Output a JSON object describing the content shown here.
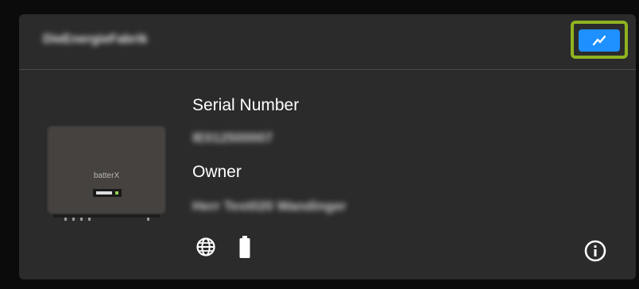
{
  "card": {
    "station_name": "DieEnergieFabrik",
    "chart_button_icon": "chart-icon"
  },
  "device": {
    "image_icon": "inverter-image",
    "brand_text": "batterX",
    "serial_label": "Serial Number",
    "serial_value": "IE012500007",
    "owner_label": "Owner",
    "owner_value": "Herr Test020 Wandinger"
  },
  "status_icons": [
    "globe-icon",
    "battery-icon"
  ],
  "info_icon": "info-icon",
  "colors": {
    "accent_blue": "#1e90ff",
    "highlight_green": "#8fb31f",
    "card_bg": "#2b2b2b",
    "page_bg": "#0b0b0b"
  }
}
